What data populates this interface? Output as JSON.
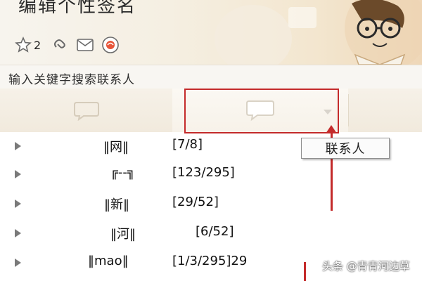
{
  "header": {
    "signature": "编辑个性签名",
    "star_count": "2"
  },
  "search": {
    "placeholder": "输入关键字搜索联系人"
  },
  "tooltip": {
    "label": "联系人"
  },
  "groups": [
    {
      "name": "‖网‖",
      "count": "[7/8]"
    },
    {
      "name": "╔--╗",
      "count": "[123/295]"
    },
    {
      "name": "‖新‖",
      "count": "[29/52]"
    },
    {
      "name": "‖河‖",
      "count": "[6/52]"
    },
    {
      "name": "‖mao‖",
      "count": "[1/3/295]29"
    }
  ],
  "watermark": "头条 @青青河边草",
  "colors": {
    "annotation_red": "#c42b2b",
    "header_bg": "#f5efe2"
  }
}
